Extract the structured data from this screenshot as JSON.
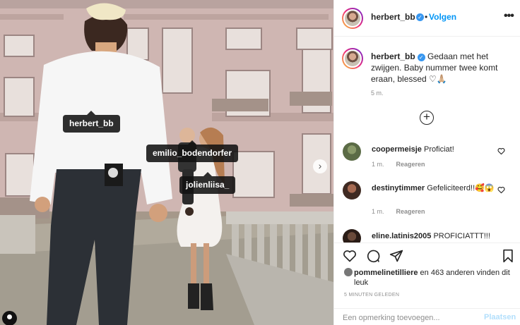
{
  "post": {
    "username": "herbert_bb",
    "verified_mark": "✓",
    "separator": "•",
    "follow_label": "Volgen",
    "more_label": "•••",
    "caption": "Gedaan met het zwijgen. Baby nummer twee komt eraan, blessed ♡🙏🏼",
    "caption_age": "5 m.",
    "add_comments_label": "+",
    "next_label": "›",
    "tags": [
      "herbert_bb",
      "emilio_bodendorfer",
      "jolienliisa_"
    ]
  },
  "comments": [
    {
      "username": "coopermeisje",
      "text": "Proficiat!",
      "age": "1 m.",
      "reply": "Reageren"
    },
    {
      "username": "destinytimmer",
      "text": "Gefeliciteerd!!🥰😱",
      "age": "1 m.",
      "reply": "Reageren"
    },
    {
      "username": "eline.latinis2005",
      "text": "PROFICIATTT!!!",
      "age": "",
      "reply": ""
    }
  ],
  "actions": {
    "likes_user": "pommelinetilliere",
    "likes_rest": " en 463 anderen vinden dit leuk",
    "time_ago": "5 MINUTEN GELEDEN"
  },
  "comment_box": {
    "placeholder": "Een opmerking toevoegen...",
    "post_label": "Plaatsen"
  },
  "colors": {
    "accent": "#0095f6",
    "verified": "#3897f0",
    "muted": "#8e8e8e",
    "text": "#262626"
  },
  "icons": [
    "heart-icon",
    "comment-icon",
    "share-icon",
    "bookmark-icon",
    "plus-circle-icon",
    "chevron-right-icon",
    "more-icon",
    "verified-icon"
  ]
}
